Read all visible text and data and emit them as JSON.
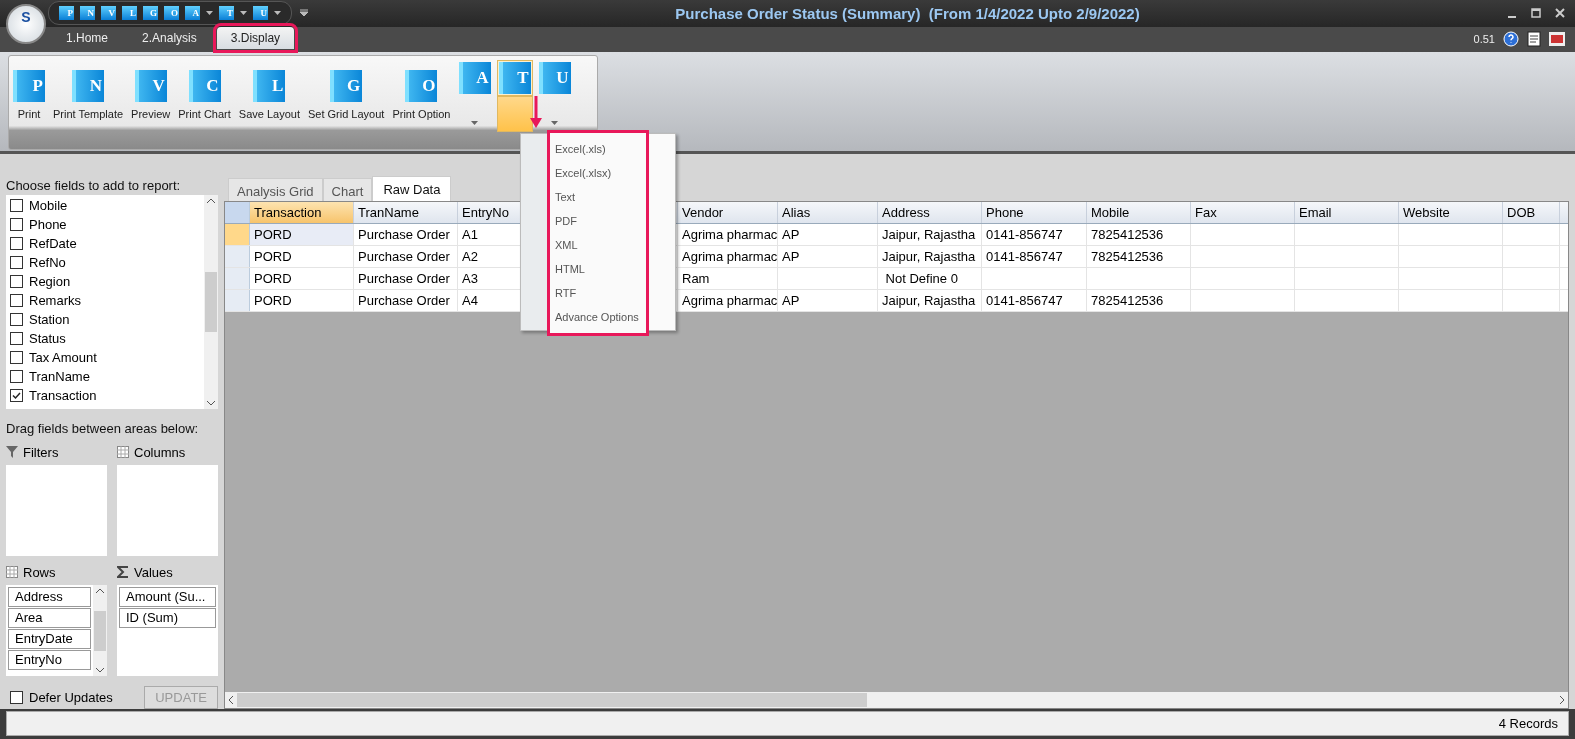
{
  "app": {
    "logo": "S"
  },
  "quick_access": [
    {
      "letter": "P",
      "dropdown": false
    },
    {
      "letter": "N",
      "dropdown": false
    },
    {
      "letter": "V",
      "dropdown": false
    },
    {
      "letter": "L",
      "dropdown": false
    },
    {
      "letter": "G",
      "dropdown": false
    },
    {
      "letter": "O",
      "dropdown": false
    },
    {
      "letter": "A",
      "dropdown": true
    },
    {
      "letter": "T",
      "dropdown": true
    },
    {
      "letter": "U",
      "dropdown": true
    }
  ],
  "window": {
    "title": "Purchase Order Status (Summary)  (From 1/4/2022 Upto 2/9/2022)"
  },
  "ribbon_tabs": [
    {
      "label": "1.Home",
      "selected": false
    },
    {
      "label": "2.Analysis",
      "selected": false
    },
    {
      "label": "3.Display",
      "selected": true
    }
  ],
  "version": "0.51",
  "ribbon_buttons": [
    {
      "kind": "large",
      "letter": "P",
      "label": "Print"
    },
    {
      "kind": "large",
      "letter": "N",
      "label": "Print Template"
    },
    {
      "kind": "large",
      "letter": "V",
      "label": "Preview"
    },
    {
      "kind": "large",
      "letter": "C",
      "label": "Print Chart"
    },
    {
      "kind": "large",
      "letter": "L",
      "label": "Save Layout"
    },
    {
      "kind": "large",
      "letter": "G",
      "label": "Set Grid Layout"
    },
    {
      "kind": "large",
      "letter": "O",
      "label": "Print Option"
    },
    {
      "kind": "split",
      "letter": "A",
      "selected": false
    },
    {
      "kind": "split",
      "letter": "T",
      "selected": true
    },
    {
      "kind": "split",
      "letter": "U",
      "selected": false
    }
  ],
  "export_menu": {
    "items": [
      "Excel(.xls)",
      "Excel(.xlsx)",
      "Text",
      "PDF",
      "XML",
      "HTML",
      "RTF",
      "Advance Options"
    ]
  },
  "field_list": {
    "title": "Choose fields to add to report:",
    "fields": [
      {
        "label": "Mobile",
        "checked": false
      },
      {
        "label": "Phone",
        "checked": false
      },
      {
        "label": "RefDate",
        "checked": false
      },
      {
        "label": "RefNo",
        "checked": false
      },
      {
        "label": "Region",
        "checked": false
      },
      {
        "label": "Remarks",
        "checked": false
      },
      {
        "label": "Station",
        "checked": false
      },
      {
        "label": "Status",
        "checked": false
      },
      {
        "label": "Tax Amount",
        "checked": false
      },
      {
        "label": "TranName",
        "checked": false
      },
      {
        "label": "Transaction",
        "checked": true
      }
    ]
  },
  "areas_title": "Drag fields between areas below:",
  "areas": [
    {
      "kind": "filter",
      "label": "Filters"
    },
    {
      "kind": "columns",
      "label": "Columns"
    },
    {
      "kind": "rows",
      "label": "Rows",
      "items": [
        "Address",
        "Area",
        "EntryDate",
        "EntryNo"
      ]
    },
    {
      "kind": "values",
      "label": "Values",
      "items": [
        "Amount (Su...",
        "ID (Sum)"
      ]
    }
  ],
  "defer_updates": {
    "label": "Defer Updates",
    "checked": false
  },
  "update_button": {
    "label": "UPDATE",
    "disabled": true
  },
  "view_tabs": [
    {
      "label": "Analysis Grid",
      "selected": false
    },
    {
      "label": "Chart",
      "selected": false
    },
    {
      "label": "Raw Data",
      "selected": true
    }
  ],
  "table": {
    "columns": [
      {
        "label": "Transaction",
        "selected": true
      },
      {
        "label": "TranName",
        "selected": false
      },
      {
        "label": "EntryNo",
        "selected": false
      },
      {
        "label": "Vendor",
        "selected": false
      },
      {
        "label": "Alias",
        "selected": false
      },
      {
        "label": "Address",
        "selected": false
      },
      {
        "label": "Phone",
        "selected": false
      },
      {
        "label": "Mobile",
        "selected": false
      },
      {
        "label": "Fax",
        "selected": false
      },
      {
        "label": "Email",
        "selected": false
      },
      {
        "label": "Website",
        "selected": false
      },
      {
        "label": "DOB",
        "selected": false
      }
    ],
    "rows": [
      {
        "selected": true,
        "cells": [
          "PORD",
          "Purchase Order",
          "A1",
          "Agrima pharmac",
          "AP",
          "Jaipur, Rajastha",
          "0141-856747",
          "7825412536",
          null,
          null,
          null,
          null
        ]
      },
      {
        "selected": false,
        "cells": [
          "PORD",
          "Purchase Order",
          "A2",
          "Agrima pharmac",
          "AP",
          "Jaipur, Rajastha",
          "0141-856747",
          "7825412536",
          null,
          null,
          null,
          null
        ]
      },
      {
        "selected": false,
        "cells": [
          "PORD",
          "Purchase Order",
          "A3",
          "Ram",
          null,
          " Not Define 0",
          null,
          null,
          null,
          null,
          null,
          null
        ]
      },
      {
        "selected": false,
        "cells": [
          "PORD",
          "Purchase Order",
          "A4",
          "Agrima pharmac",
          "AP",
          "Jaipur, Rajastha",
          "0141-856747",
          "7825412536",
          null,
          null,
          null,
          null
        ]
      }
    ]
  },
  "status_bar": {
    "records": "4 Records"
  }
}
